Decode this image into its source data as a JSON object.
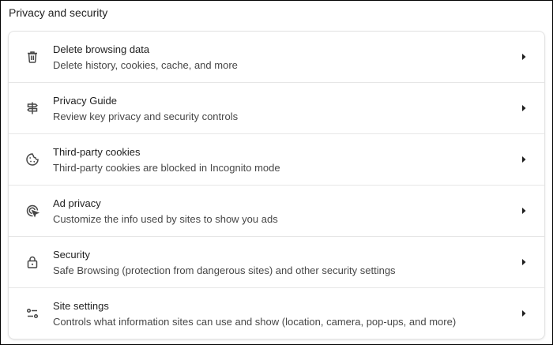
{
  "section": {
    "title": "Privacy and security"
  },
  "items": [
    {
      "title": "Delete browsing data",
      "subtitle": "Delete history, cookies, cache, and more",
      "icon": "trash-icon"
    },
    {
      "title": "Privacy Guide",
      "subtitle": "Review key privacy and security controls",
      "icon": "signpost-icon"
    },
    {
      "title": "Third-party cookies",
      "subtitle": "Third-party cookies are blocked in Incognito mode",
      "icon": "cookie-icon"
    },
    {
      "title": "Ad privacy",
      "subtitle": "Customize the info used by sites to show you ads",
      "icon": "ad-privacy-icon"
    },
    {
      "title": "Security",
      "subtitle": "Safe Browsing (protection from dangerous sites) and other security settings",
      "icon": "lock-icon"
    },
    {
      "title": "Site settings",
      "subtitle": "Controls what information sites can use and show (location, camera, pop-ups, and more)",
      "icon": "tune-icon"
    }
  ],
  "colors": {
    "text_primary": "#1f1f1f",
    "text_secondary": "#474747",
    "icon": "#474747",
    "divider": "#e6e6e6"
  }
}
